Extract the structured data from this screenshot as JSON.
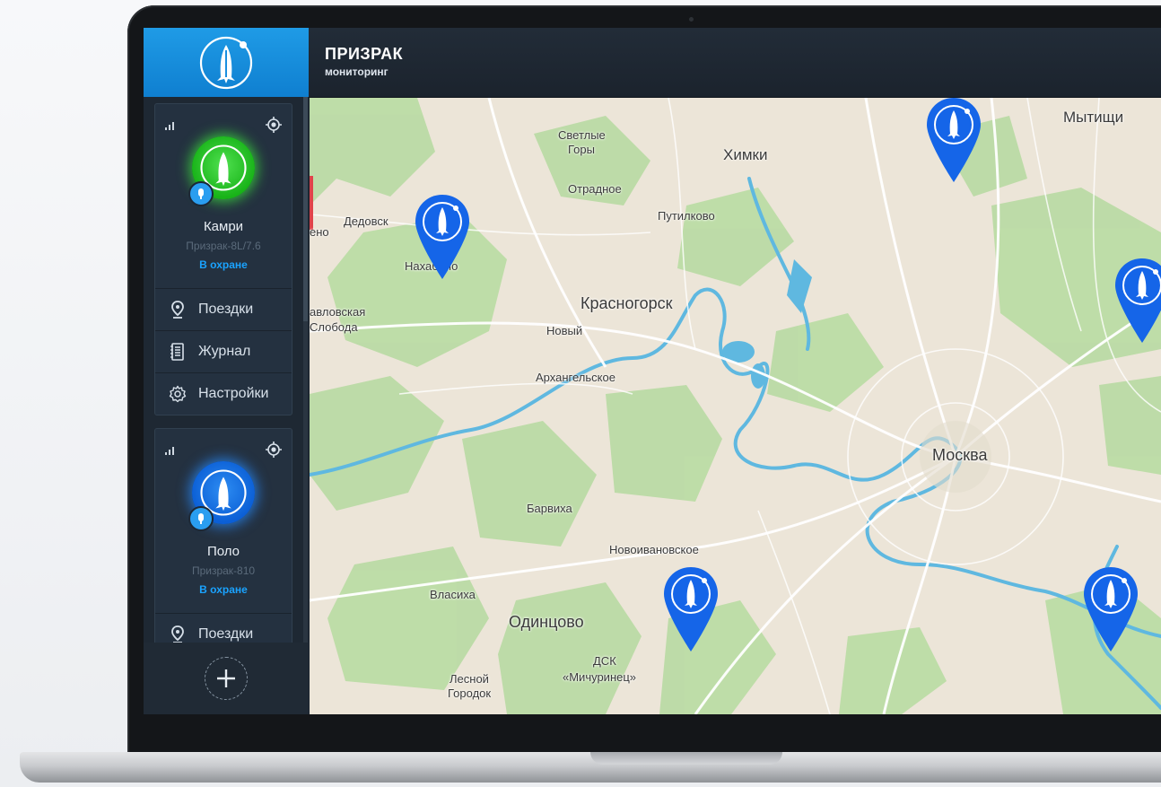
{
  "app": {
    "title": "ПРИЗРАК",
    "subtitle": "мониторинг"
  },
  "colors": {
    "accent": "#1f9be6",
    "status": "#1aa3ff",
    "pin": "#1565e8",
    "active_green": "#2ed02e"
  },
  "vehicles": [
    {
      "name": "Камри",
      "model": "Призрак-8L/7.6",
      "status": "В охране",
      "avatar": "green",
      "menu": [
        {
          "label": "Поездки",
          "icon": "map-pin-icon"
        },
        {
          "label": "Журнал",
          "icon": "journal-icon"
        },
        {
          "label": "Настройки",
          "icon": "gear-icon"
        }
      ]
    },
    {
      "name": "Поло",
      "model": "Призрак-810",
      "status": "В охране",
      "avatar": "blue",
      "menu": [
        {
          "label": "Поездки",
          "icon": "map-pin-icon"
        }
      ]
    }
  ],
  "map": {
    "labels": [
      {
        "id": "svetlye-gory-1",
        "text": "Светлые"
      },
      {
        "id": "svetlye-gory-2",
        "text": "Горы"
      },
      {
        "id": "khimki",
        "text": "Химки"
      },
      {
        "id": "mytishchi",
        "text": "Мытищи"
      },
      {
        "id": "otradnoe",
        "text": "Отрадное"
      },
      {
        "id": "dedovsk",
        "text": "Дедовск"
      },
      {
        "id": "putilkovo",
        "text": "Путилково"
      },
      {
        "id": "nakhabino",
        "text": "Нахабино"
      },
      {
        "id": "krasnogorsk",
        "text": "Красногорск"
      },
      {
        "id": "pavlovskaya-1",
        "text": "авловская"
      },
      {
        "id": "pavlovskaya-2",
        "text": "Слобода"
      },
      {
        "id": "novyy",
        "text": "Новый"
      },
      {
        "id": "arkhangelskoe",
        "text": "Архангельское"
      },
      {
        "id": "moskva",
        "text": "Москва"
      },
      {
        "id": "barvikha",
        "text": "Барвиха"
      },
      {
        "id": "novoivanovskoe",
        "text": "Новоивановское"
      },
      {
        "id": "vlasikha",
        "text": "Власиха"
      },
      {
        "id": "odintsovo",
        "text": "Одинцово"
      },
      {
        "id": "lesnoy-1",
        "text": "Лесной"
      },
      {
        "id": "lesnoy-2",
        "text": "Городок"
      },
      {
        "id": "dsk-1",
        "text": "ДСК"
      },
      {
        "id": "dsk-2",
        "text": "«Мичуринец»"
      },
      {
        "id": "edge-eno",
        "text": "ено"
      }
    ],
    "pins": 5
  }
}
